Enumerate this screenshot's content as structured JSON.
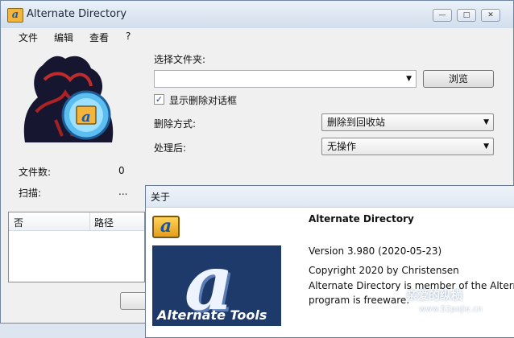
{
  "window": {
    "title": "Alternate Directory"
  },
  "menu": {
    "items": [
      "文件",
      "编辑",
      "查看",
      "?"
    ]
  },
  "main": {
    "select_folder_label": "选择文件夹:",
    "folder_value": "",
    "browse_label": "浏览",
    "show_delete_dialog_label": "显示删除对话框",
    "show_delete_dialog_checked": true,
    "delete_method_label": "删除方式:",
    "delete_method_value": "删除到回收站",
    "after_label": "处理后:",
    "after_value": "无操作",
    "file_count_label": "文件数:",
    "file_count_value": "0",
    "scan_label": "扫描:",
    "scan_value": "...",
    "list": {
      "columns": [
        "否",
        "路径"
      ]
    }
  },
  "about": {
    "title": "关于",
    "app_name": "Alternate Directory",
    "version": "Version 3.980 (2020-05-23)",
    "copyright": "Copyright 2020 by Christensen",
    "line1": "Alternate Directory is member of the Alterna",
    "line2": "program is freeware.",
    "logo_text": "Alternate Tools",
    "logo_letter": "a"
  },
  "watermark": {
    "line1": "亲爱的纵横",
    "line2": "www.52pojie.cn"
  },
  "colors": {
    "accent": "#1d3a6a",
    "title_gradient": "#d2deec"
  }
}
